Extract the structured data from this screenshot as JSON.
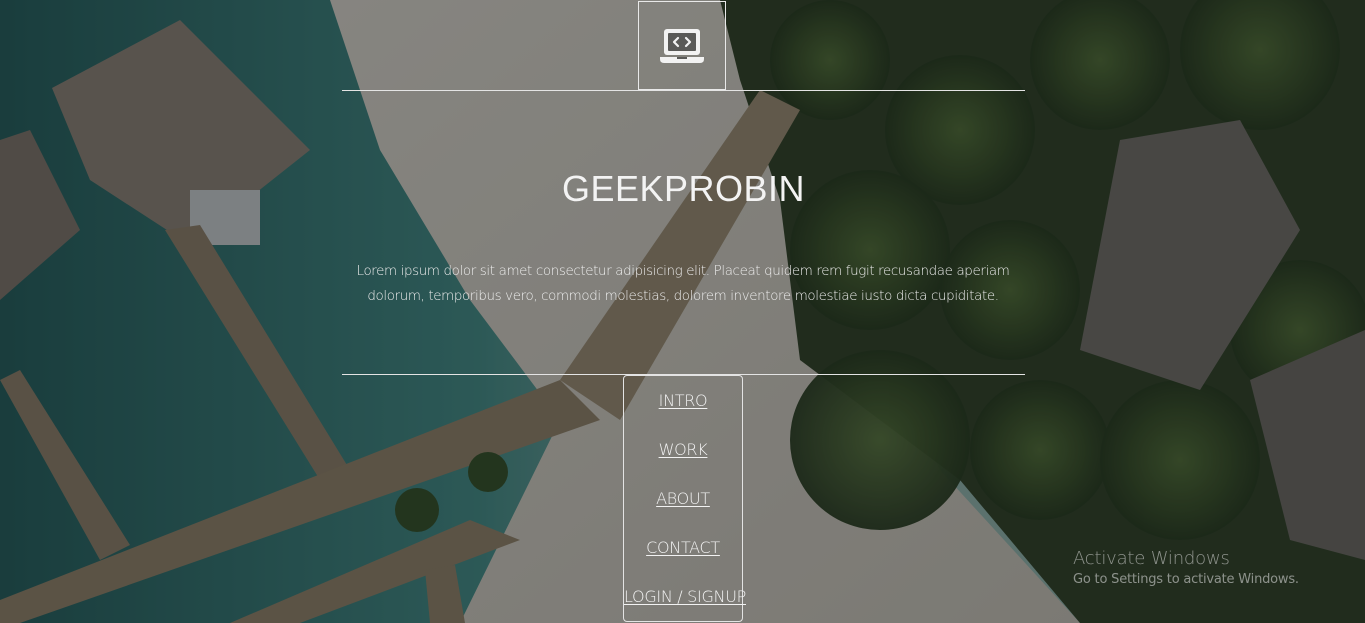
{
  "header": {
    "logo_icon": "laptop-code-icon"
  },
  "hero": {
    "title": "GEEKPROBIN",
    "description": "Lorem ipsum dolor sit amet consectetur adipisicing elit. Placeat quidem rem fugit recusandae aperiam dolorum, temporibus vero, commodi molestias, dolorem inventore molestiae iusto dicta cupiditate."
  },
  "nav": {
    "items": [
      {
        "label": "INTRO"
      },
      {
        "label": "WORK"
      },
      {
        "label": "ABOUT"
      },
      {
        "label": "CONTACT"
      },
      {
        "label": "LOGIN / SIGNUP"
      }
    ]
  },
  "watermark": {
    "title": "Activate Windows",
    "subtitle": "Go to Settings to activate Windows."
  },
  "colors": {
    "text": "#f2f2f2",
    "lines": "#e4e4e4",
    "overlay": "#1a1c1c"
  }
}
